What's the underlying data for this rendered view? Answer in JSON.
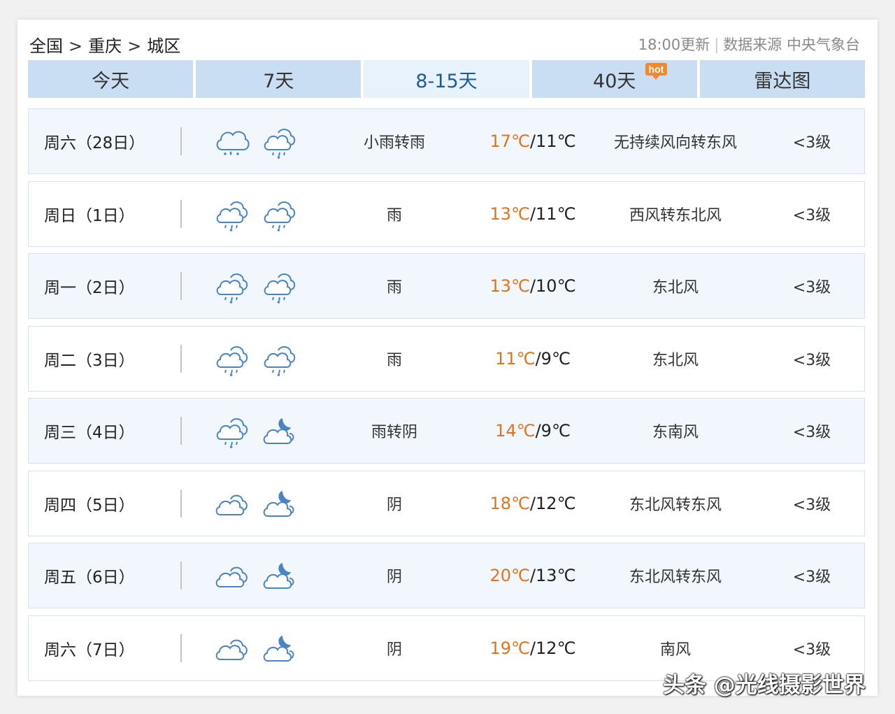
{
  "breadcrumb": {
    "country": "全国",
    "city": "重庆",
    "district": "城区",
    "separator": ">"
  },
  "update": {
    "time_text": "18:00更新",
    "source_text": "数据来源 中央气象台"
  },
  "tabs": [
    {
      "label": "今天"
    },
    {
      "label": "7天"
    },
    {
      "label": "8-15天"
    },
    {
      "label": "40天",
      "badge": "hot"
    },
    {
      "label": "雷达图"
    }
  ],
  "active_tab": "8-15天",
  "colors": {
    "tab_bg": "#c9def3",
    "active_tab_bg": "#e8f2fc",
    "high_temp": "#e0741e",
    "icon_stroke": "#4a84c2",
    "hot_badge": "#f08a2c"
  },
  "forecast": [
    {
      "day": "周六（28日）",
      "icon_day": "rain-cloud-icon",
      "icon_night": "light-rain-icon",
      "weather": "小雨转雨",
      "high": "17℃",
      "low": "/11℃",
      "wind": "无持续风向转东风",
      "level": "<3级"
    },
    {
      "day": "周日（1日）",
      "icon_day": "light-rain-icon",
      "icon_night": "light-rain-icon",
      "weather": "雨",
      "high": "13℃",
      "low": "/11℃",
      "wind": "西风转东北风",
      "level": "<3级"
    },
    {
      "day": "周一（2日）",
      "icon_day": "light-rain-icon",
      "icon_night": "light-rain-icon",
      "weather": "雨",
      "high": "13℃",
      "low": "/10℃",
      "wind": "东北风",
      "level": "<3级"
    },
    {
      "day": "周二（3日）",
      "icon_day": "light-rain-icon",
      "icon_night": "light-rain-icon",
      "weather": "雨",
      "high": "11℃",
      "low": "/9℃",
      "wind": "东北风",
      "level": "<3级"
    },
    {
      "day": "周三（4日）",
      "icon_day": "light-rain-icon",
      "icon_night": "cloudy-night-icon",
      "weather": "雨转阴",
      "high": "14℃",
      "low": "/9℃",
      "wind": "东南风",
      "level": "<3级"
    },
    {
      "day": "周四（5日）",
      "icon_day": "overcast-icon",
      "icon_night": "cloudy-night-icon",
      "weather": "阴",
      "high": "18℃",
      "low": "/12℃",
      "wind": "东北风转东风",
      "level": "<3级"
    },
    {
      "day": "周五（6日）",
      "icon_day": "overcast-icon",
      "icon_night": "cloudy-night-icon",
      "weather": "阴",
      "high": "20℃",
      "low": "/13℃",
      "wind": "东北风转东风",
      "level": "<3级"
    },
    {
      "day": "周六（7日）",
      "icon_day": "overcast-icon",
      "icon_night": "cloudy-night-icon",
      "weather": "阴",
      "high": "19℃",
      "low": "/12℃",
      "wind": "南风",
      "level": "<3级"
    }
  ],
  "watermark": "头条 @光线摄影世界"
}
